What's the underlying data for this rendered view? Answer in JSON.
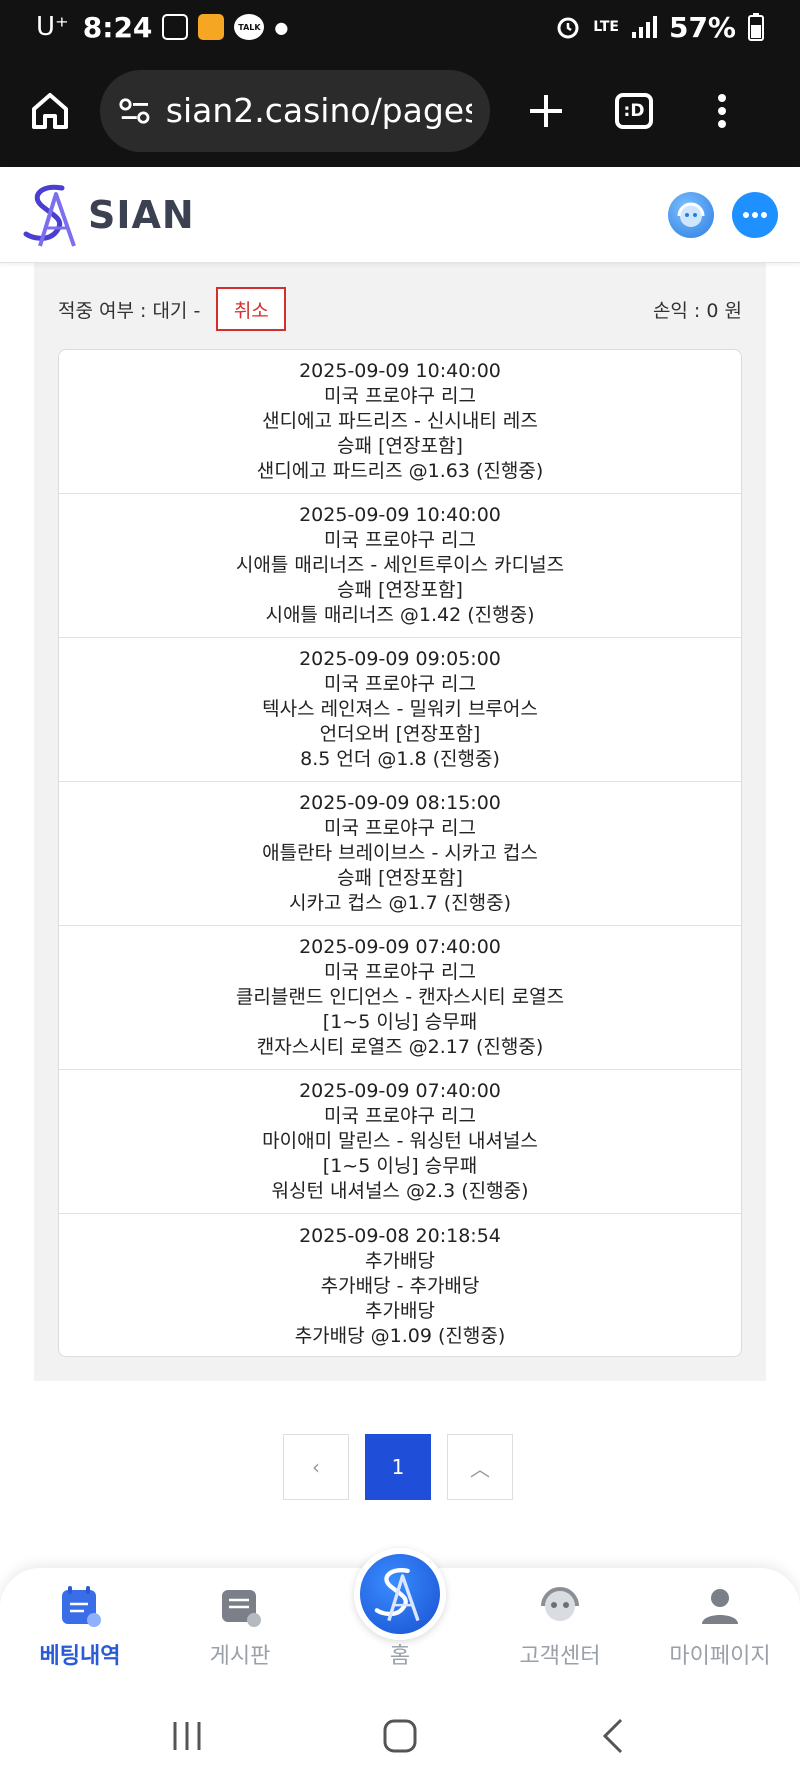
{
  "statusbar": {
    "carrier": "U⁺",
    "time": "8:24",
    "talk_badge": "TALK",
    "network": "LTE",
    "battery": "57%"
  },
  "browser": {
    "url": "sian2.casino/pages/",
    "tabs_label": ":D"
  },
  "header": {
    "brand": "SIAN"
  },
  "summary": {
    "status_label": "적중 여부 : 대기 -",
    "cancel_label": "취소",
    "profit_label": "손익 : 0 원"
  },
  "bets": [
    {
      "datetime": "2025-09-09 10:40:00",
      "league": "미국 프로야구 리그",
      "match": "샌디에고 파드리즈 - 신시내티 레즈",
      "market": "승패 [연장포함]",
      "pick": "샌디에고 파드리즈 @1.63 (진행중)"
    },
    {
      "datetime": "2025-09-09 10:40:00",
      "league": "미국 프로야구 리그",
      "match": "시애틀 매리너즈 - 세인트루이스 카디널즈",
      "market": "승패 [연장포함]",
      "pick": "시애틀 매리너즈 @1.42 (진행중)"
    },
    {
      "datetime": "2025-09-09 09:05:00",
      "league": "미국 프로야구 리그",
      "match": "텍사스 레인져스 - 밀워키 브루어스",
      "market": "언더오버 [연장포함]",
      "pick": "8.5 언더 @1.8 (진행중)"
    },
    {
      "datetime": "2025-09-09 08:15:00",
      "league": "미국 프로야구 리그",
      "match": "애틀란타 브레이브스 - 시카고 컵스",
      "market": "승패 [연장포함]",
      "pick": "시카고 컵스 @1.7 (진행중)"
    },
    {
      "datetime": "2025-09-09 07:40:00",
      "league": "미국 프로야구 리그",
      "match": "클리블랜드 인디언스 - 캔자스시티 로열즈",
      "market": "[1~5 이닝] 승무패",
      "pick": "캔자스시티 로열즈 @2.17 (진행중)"
    },
    {
      "datetime": "2025-09-09 07:40:00",
      "league": "미국 프로야구 리그",
      "match": "마이애미 말린스 - 워싱턴 내셔널스",
      "market": "[1~5 이닝] 승무패",
      "pick": "워싱턴 내셔널스 @2.3 (진행중)"
    },
    {
      "datetime": "2025-09-08 20:18:54",
      "league": "추가배당",
      "match": "추가배당 - 추가배당",
      "market": "추가배당",
      "pick": "추가배당 @1.09 (진행중)"
    }
  ],
  "pagination": {
    "prev": "‹",
    "current": "1",
    "top": "︿"
  },
  "bottomnav": {
    "bet_history": "베팅내역",
    "board": "게시판",
    "home": "홈",
    "support": "고객센터",
    "mypage": "마이페이지"
  }
}
